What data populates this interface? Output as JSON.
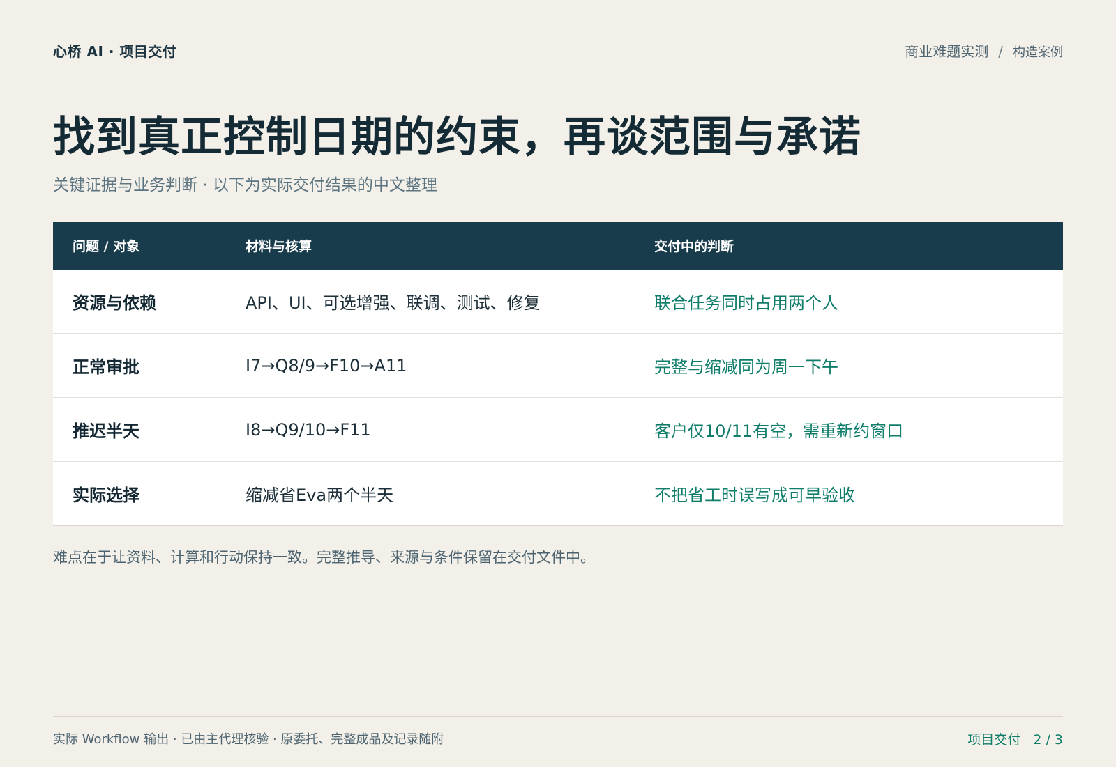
{
  "header": {
    "brand": "心桥 AI · 项目交付",
    "nav_primary": "商业难题实测",
    "nav_separator": "/",
    "nav_secondary": "构造案例"
  },
  "title": "找到真正控制日期的约束，再谈范围与承诺",
  "subtitle": "关键证据与业务判断 · 以下为实际交付结果的中文整理",
  "table": {
    "columns": [
      "问题 / 对象",
      "材料与核算",
      "交付中的判断"
    ],
    "rows": [
      {
        "topic": "资源与依赖",
        "material": "API、UI、可选增强、联调、测试、修复",
        "judgment": "联合任务同时占用两个人"
      },
      {
        "topic": "正常审批",
        "material": "I7→Q8/9→F10→A11",
        "judgment": "完整与缩减同为周一下午"
      },
      {
        "topic": "推迟半天",
        "material": "I8→Q9/10→F11",
        "judgment": "客户仅10/11有空，需重新约窗口"
      },
      {
        "topic": "实际选择",
        "material": "缩减省Eva两个半天",
        "judgment": "不把省工时误写成可早验收"
      }
    ]
  },
  "note": "难点在于让资料、计算和行动保持一致。完整推导、来源与条件保留在交付文件中。",
  "footer": {
    "left": "实际 Workflow 输出 · 已由主代理核验 · 原委托、完整成品及记录随附",
    "section": "项目交付",
    "page": "2 / 3"
  },
  "colors": {
    "background": "#f3f0ea",
    "header_fill": "#183c4c",
    "accent": "#0f7d6a",
    "title": "#142a35"
  }
}
